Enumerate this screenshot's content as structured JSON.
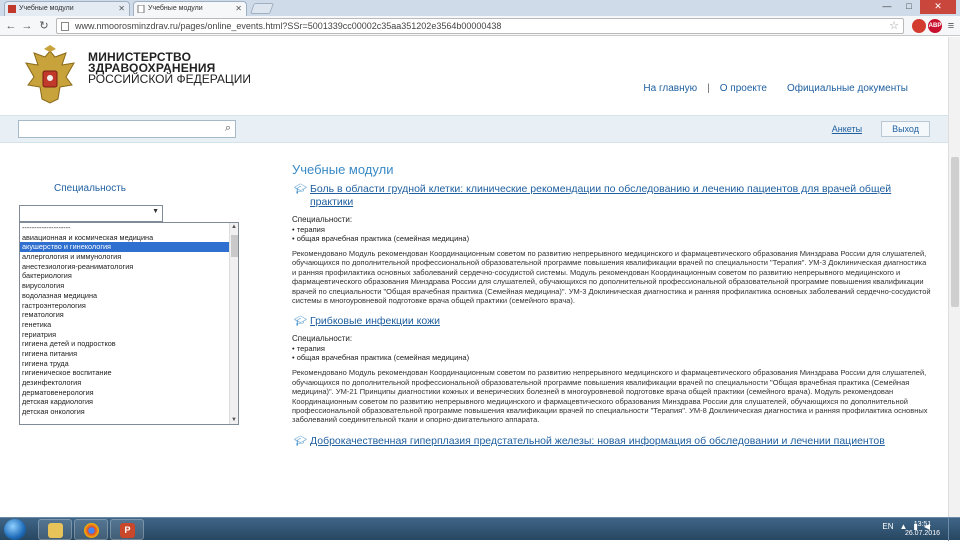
{
  "browser": {
    "tabs": [
      {
        "label": "Учебные модули",
        "active": false
      },
      {
        "label": "Учебные модули",
        "active": true
      }
    ],
    "url": "www.nmoorosminzdrav.ru/pages/online_events.html?SSr=5001339cc00002c35aa351202e3564b00000438",
    "ext_label": "ABP",
    "window_controls": [
      "—",
      "□",
      "✕"
    ]
  },
  "header": {
    "ministry_line1": "МИНИСТЕРСТВО",
    "ministry_line2": "ЗДРАВООХРАНЕНИЯ",
    "ministry_line3": "РОССИЙСКОЙ ФЕДЕРАЦИИ",
    "nav": [
      "На главную",
      "О проекте",
      "Официальные документы"
    ],
    "nav_separator": "|"
  },
  "searchbar": {
    "search_placeholder": "",
    "register_label": "Анкеты",
    "login_label": "Выход"
  },
  "sidebar": {
    "title": "Специальность",
    "select_value": "",
    "options": [
      "--------------------",
      "авиационная и космическая медицина",
      "акушерство и гинекология",
      "аллергология и иммунология",
      "анестезиология-реаниматология",
      "бактериология",
      "вирусология",
      "водолазная медицина",
      "гастроэнтерология",
      "гематология",
      "генетика",
      "гериатрия",
      "гигиена детей и подростков",
      "гигиена питания",
      "гигиена труда",
      "гигиеническое воспитание",
      "дезинфектология",
      "дерматовенерология",
      "детская кардиология",
      "детская онкология"
    ],
    "selected_index": 2
  },
  "main": {
    "section_title": "Учебные модули",
    "specialties_label": "Специальности:",
    "modules": [
      {
        "title": "Боль в области грудной клетки: клинические рекомендации по обследованию и лечению пациентов для врачей общей практики",
        "specialties": [
          "терапия",
          "общая врачебная практика (семейная медицина)"
        ],
        "description": "Рекомендовано Модуль рекомендован Координационным советом по развитию непрерывного медицинского и фармацевтического образования Минздрава России для слушателей, обучающихся по дополнительной профессиональной образовательной программе повышения квалификации врачей по специальности \"Терапия\". УМ-3 Доклиническая диагностика и ранняя профилактика основных заболеваний сердечно-сосудистой системы. Модуль рекомендован Координационным советом по развитию непрерывного медицинского и фармацевтического образования Минздрава России для слушателей, обучающихся по дополнительной профессиональной образовательной программе повышения квалификации врачей по специальности \"Общая врачебная практика (Семейная медицина)\". УМ-3 Доклиническая диагностика и ранняя профилактика основных заболеваний сердечно-сосудистой системы в многоуровневой подготовке врача общей практики (семейного врача)."
      },
      {
        "title": "Грибковые инфекции кожи",
        "specialties": [
          "терапия",
          "общая врачебная практика (семейная медицина)"
        ],
        "description": "Рекомендовано Модуль рекомендован Координационным советом по развитию непрерывного медицинского и фармацевтического образования Минздрава России для слушателей, обучающихся по дополнительной профессиональной образовательной программе повышения квалификации врачей по специальности \"Общая врачебная практика (Семейная медицина)\". УМ-21 Принципы диагностики кожных и венерических болезней в многоуровневой подготовке врача общей практики (семейного врача). Модуль рекомендован Координационным советом по развитию непрерывного медицинского и фармацевтического образования Минздрава России для слушателей, обучающихся по дополнительной профессиональной образовательной программе повышения квалификации врачей по специальности \"Терапия\". УМ-8 Доклиническая диагностика и ранняя профилактика основных заболеваний соединительной ткани и опорно-двигательного аппарата."
      },
      {
        "title": "Доброкачественная гиперплазия предстательной железы: новая информация об обследовании и лечении пациентов",
        "specialties": [],
        "description": ""
      }
    ]
  },
  "taskbar": {
    "tray_lang": "EN",
    "time": "13:51",
    "date": "26.07.2016"
  },
  "colors": {
    "link": "#1f5f9f",
    "heading": "#3a8ac6",
    "searchbar_bg": "#e9f0f5",
    "selected_option": "#2f6fd0"
  }
}
